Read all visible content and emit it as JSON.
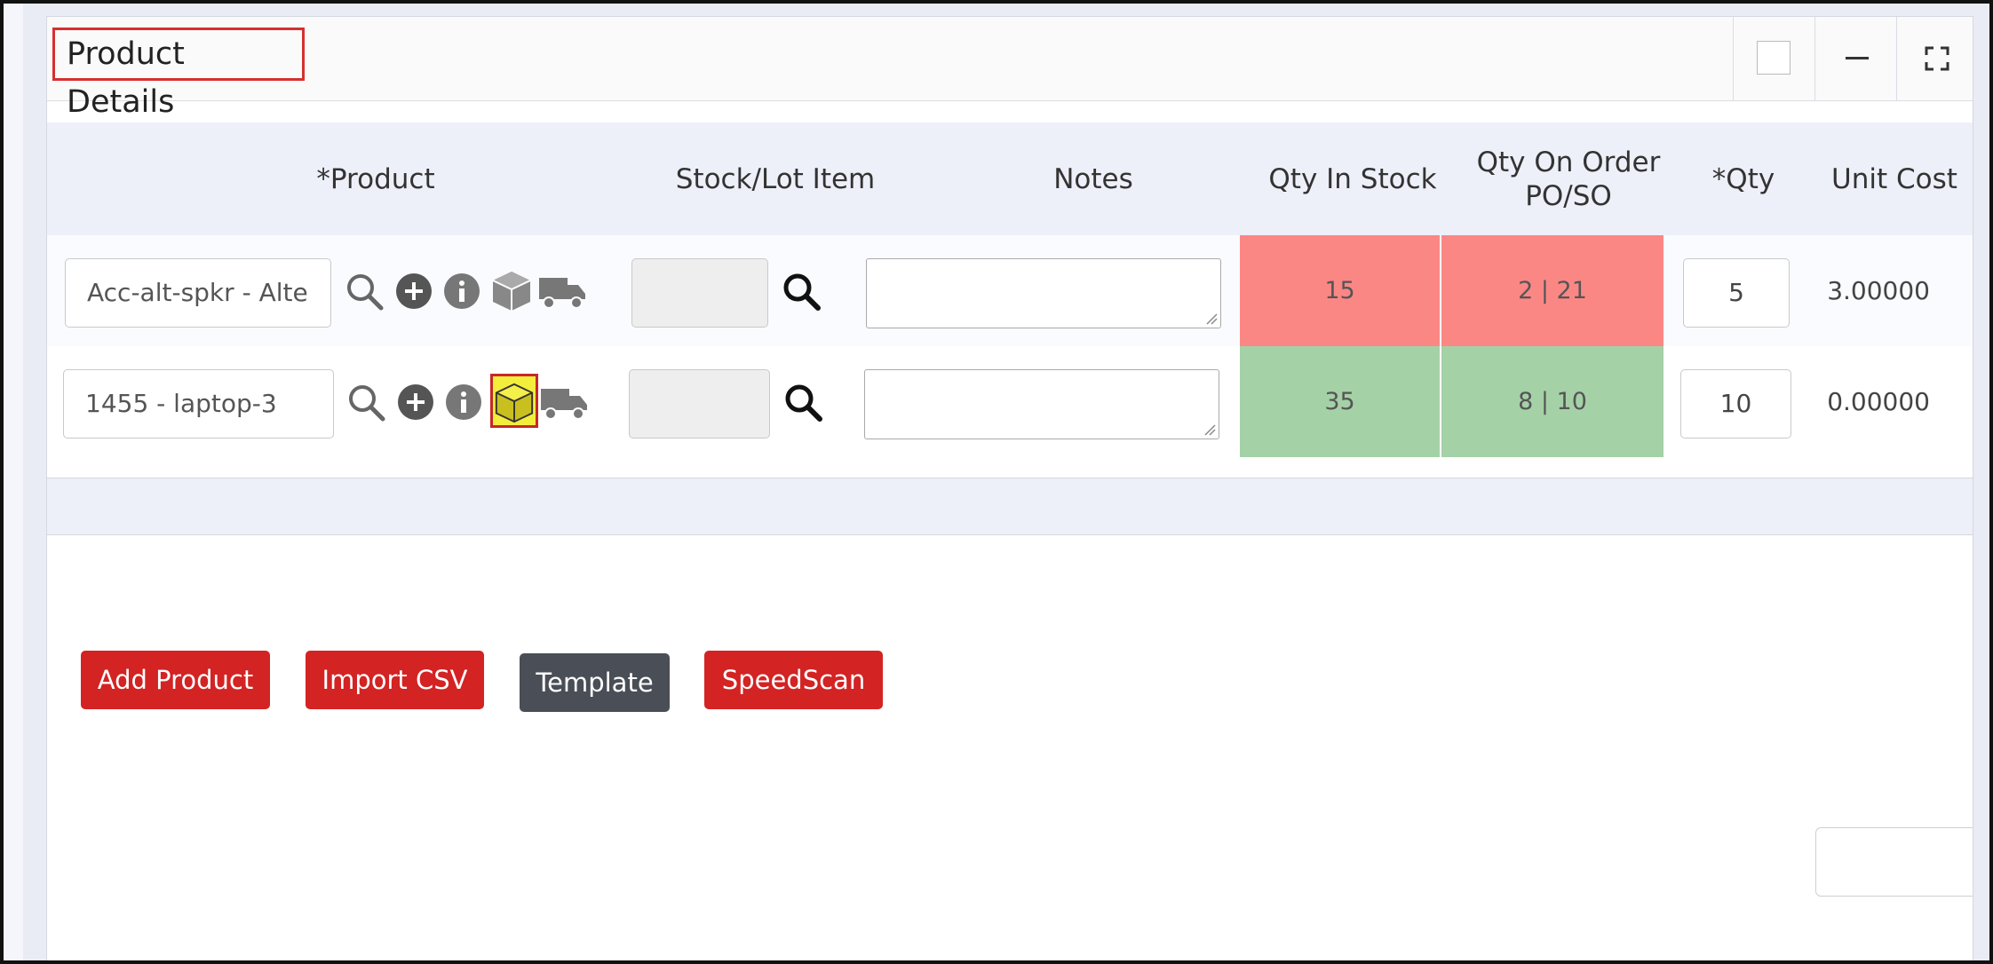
{
  "panel": {
    "title": "Product Details"
  },
  "table": {
    "headers": {
      "product": "*Product",
      "stock_lot": "Stock/Lot Item",
      "notes": "Notes",
      "qty_in_stock": "Qty In Stock",
      "qty_on_order_line1": "Qty On Order",
      "qty_on_order_line2": "PO/SO",
      "qty": "*Qty",
      "unit_cost": "Unit Cost"
    },
    "rows": [
      {
        "product": "Acc-alt-spkr - Alte",
        "stock_lot": "",
        "notes": "",
        "qty_in_stock": "15",
        "qty_on_order": "2 | 21",
        "qty": "5",
        "unit_cost": "3.00000",
        "stock_status_color": "#fb8785"
      },
      {
        "product": "1455 - laptop-3",
        "stock_lot": "",
        "notes": "",
        "qty_in_stock": "35",
        "qty_on_order": "8 | 10",
        "qty": "10",
        "unit_cost": "0.00000",
        "stock_status_color": "#a5d1a7"
      }
    ]
  },
  "buttons": {
    "add_product": "Add Product",
    "import_csv": "Import CSV",
    "template": "Template",
    "speedscan": "SpeedScan"
  },
  "colors": {
    "accent_red": "#d32323",
    "dark_button": "#4a4e56",
    "header_band": "#eef0f9",
    "highlight": "#f3ee3c"
  },
  "icons": [
    "search-icon",
    "plus-circle-icon",
    "info-icon",
    "box-icon",
    "truck-icon",
    "expand-icon",
    "minimize-icon"
  ]
}
